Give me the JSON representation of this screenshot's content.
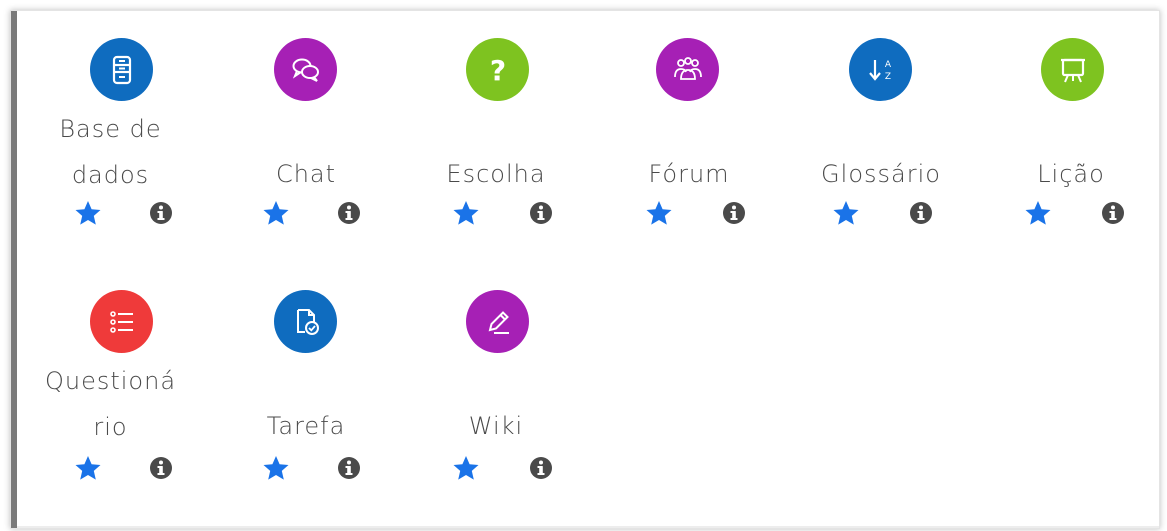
{
  "modules": [
    {
      "id": "database",
      "label_lines": [
        "Base de",
        "dados"
      ],
      "icon": "database-icon",
      "color": "#0f6cbf"
    },
    {
      "id": "chat",
      "label_lines": [
        "Chat"
      ],
      "icon": "chat-icon",
      "color": "#a620b5"
    },
    {
      "id": "choice",
      "label_lines": [
        "Escolha"
      ],
      "icon": "question-icon",
      "color": "#7ec320"
    },
    {
      "id": "forum",
      "label_lines": [
        "Fórum"
      ],
      "icon": "people-icon",
      "color": "#a620b5"
    },
    {
      "id": "glossary",
      "label_lines": [
        "Glossário"
      ],
      "icon": "sort-az-icon",
      "color": "#0f6cbf"
    },
    {
      "id": "lesson",
      "label_lines": [
        "Lição"
      ],
      "icon": "presentation-icon",
      "color": "#7ec320"
    },
    {
      "id": "quiz",
      "label_lines": [
        "Questioná",
        "rio"
      ],
      "icon": "list-icon",
      "color": "#ef3a3a"
    },
    {
      "id": "assign",
      "label_lines": [
        "Tarefa"
      ],
      "icon": "document-check-icon",
      "color": "#0f6cbf"
    },
    {
      "id": "wiki",
      "label_lines": [
        "Wiki"
      ],
      "icon": "pencil-icon",
      "color": "#a620b5"
    }
  ],
  "star_color": "#1a73e8",
  "info_color": "#4a4a4a"
}
